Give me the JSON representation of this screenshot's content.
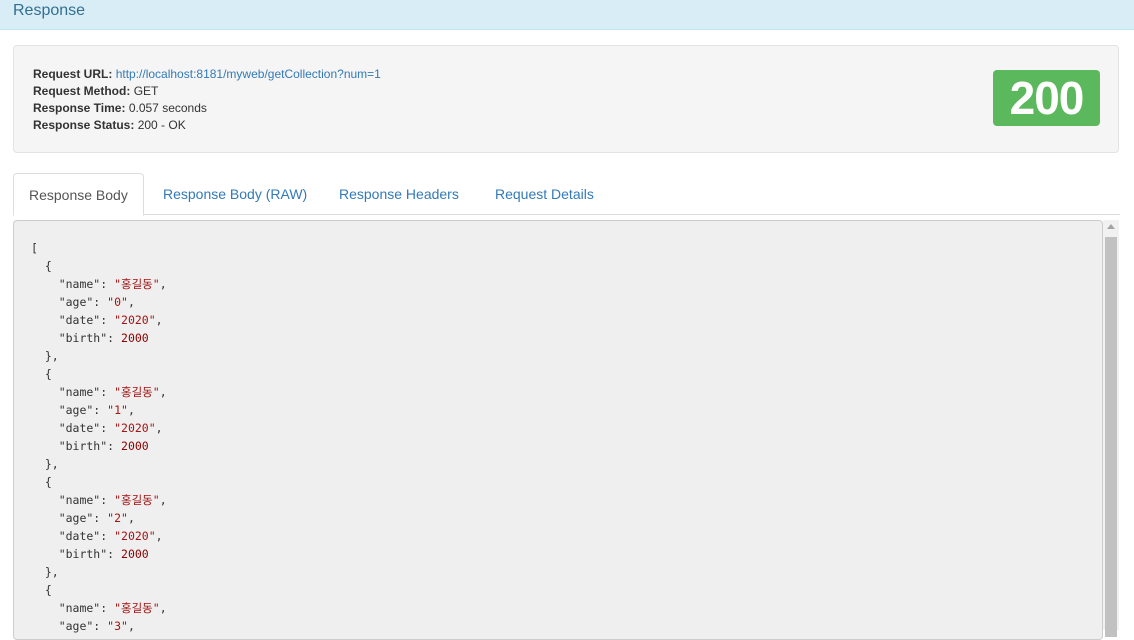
{
  "header": {
    "title": "Response"
  },
  "summary": {
    "request_url_label": "Request URL:",
    "request_url": "http://localhost:8181/myweb/getCollection?num=1",
    "request_method_label": "Request Method:",
    "request_method": "GET",
    "response_time_label": "Response Time:",
    "response_time": "0.057 seconds",
    "response_status_label": "Response Status:",
    "response_status": "200 - OK",
    "status_code": "200"
  },
  "tabs": [
    {
      "label": "Response Body",
      "active": true
    },
    {
      "label": "Response Body (RAW)",
      "active": false
    },
    {
      "label": "Response Headers",
      "active": false
    },
    {
      "label": "Request Details",
      "active": false
    }
  ],
  "body": {
    "open_bracket": "[",
    "items": [
      {
        "name": "홍길동",
        "age": "0",
        "date": "2020",
        "birth": "2000"
      },
      {
        "name": "홍길동",
        "age": "1",
        "date": "2020",
        "birth": "2000"
      },
      {
        "name": "홍길동",
        "age": "2",
        "date": "2020",
        "birth": "2000"
      },
      {
        "name": "홍길동",
        "age": "3"
      }
    ]
  },
  "colors": {
    "header_bg": "#d9edf7",
    "status_badge": "#5cb85c",
    "link": "#337ab7",
    "string_value": "#a31515"
  }
}
